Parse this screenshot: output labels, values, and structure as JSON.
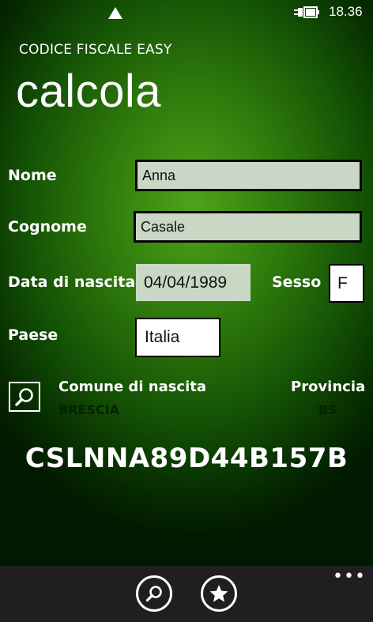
{
  "status": {
    "time": "18.36"
  },
  "app": {
    "name": "CODICE FISCALE EASY",
    "page": "calcola"
  },
  "form": {
    "nome_label": "Nome",
    "nome_value": "Anna",
    "cognome_label": "Cognome",
    "cognome_value": "Casale",
    "data_label": "Data di nascita",
    "data_value": "04/04/1989",
    "sesso_label": "Sesso",
    "sesso_value": "F",
    "paese_label": "Paese",
    "paese_value": "Italia"
  },
  "comune": {
    "label": "Comune di nascita",
    "value": "BRESCIA",
    "provincia_label": "Provincia",
    "provincia_value": "BS"
  },
  "result": {
    "codice": "CSLNNA89D44B157B"
  },
  "appbar": {
    "more": "•••"
  },
  "icons": {
    "signal": "signal-icon",
    "battery": "battery-charging-icon",
    "search": "search-icon",
    "favorite": "star-icon"
  },
  "colors": {
    "accent": "#2f7a0c",
    "field_bg": "#c9d8c5",
    "appbar": "#1f1f1f"
  }
}
